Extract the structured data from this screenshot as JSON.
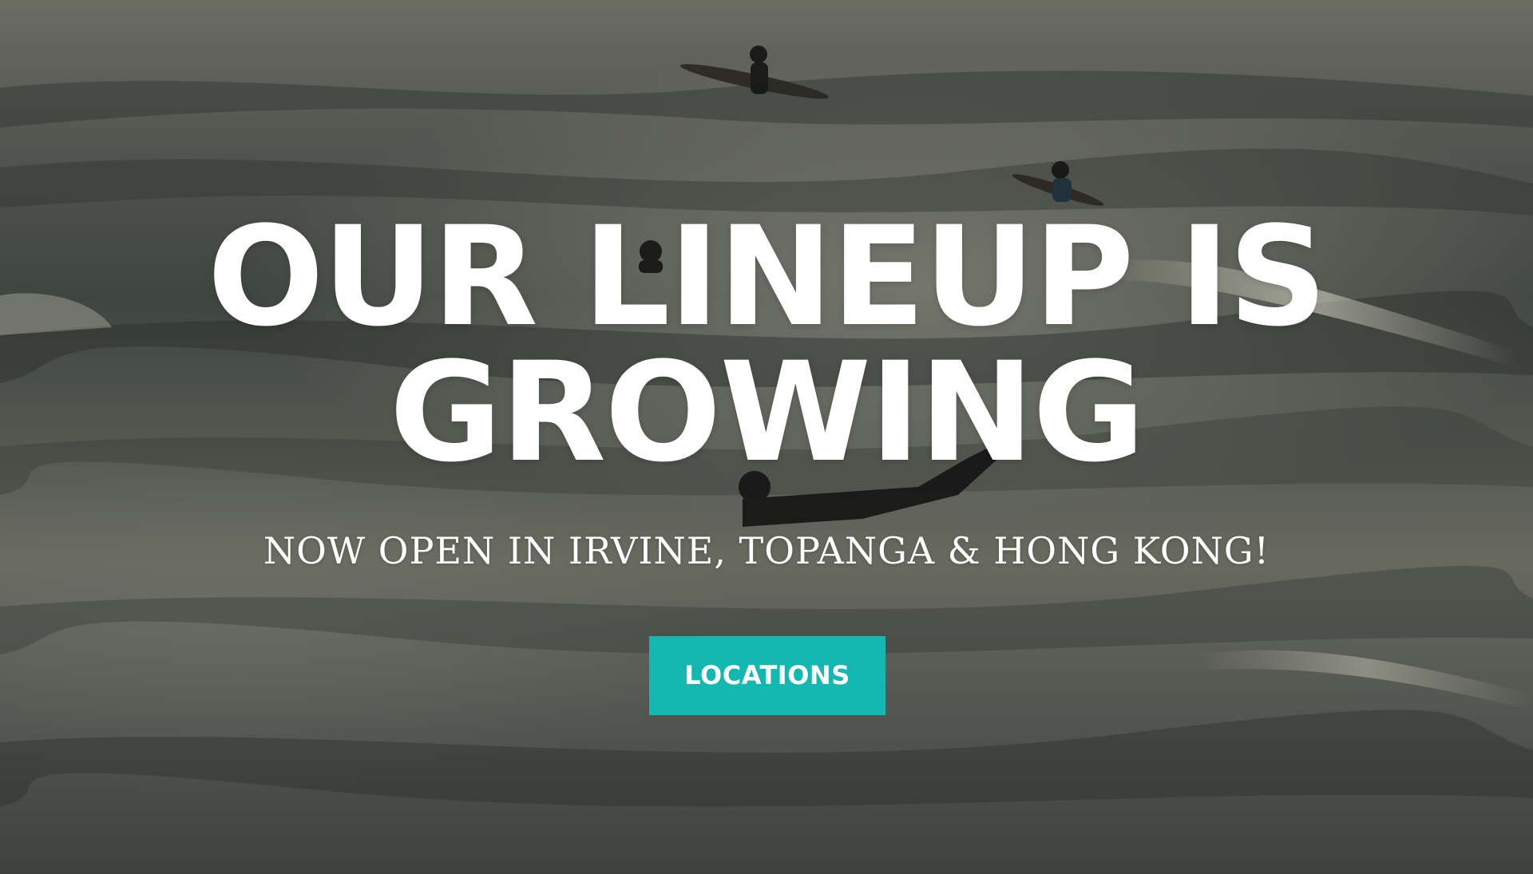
{
  "hero": {
    "headline_line1": "OUR LINEUP IS",
    "headline_line2": "GROWING",
    "subheadline": "NOW OPEN IN IRVINE, TOPANGA & HONG KONG!",
    "cta_label": "LOCATIONS"
  },
  "colors": {
    "cta_background": "#13b8b0",
    "text": "#ffffff"
  }
}
